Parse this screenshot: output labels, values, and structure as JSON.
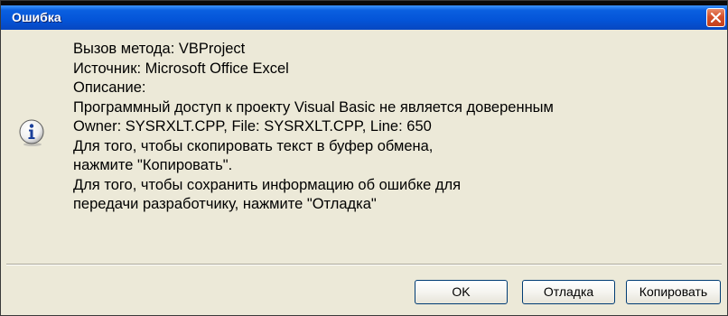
{
  "window": {
    "title": "Ошибка"
  },
  "icons": {
    "message_icon": "information-icon",
    "close_icon": "close-icon"
  },
  "message": {
    "lines": [
      "Вызов метода: VBProject",
      "Источник: Microsoft Office Excel",
      "Описание:",
      "Программный доступ к проекту Visual Basic не является доверенным",
      "Owner: SYSRXLT.CPP, File: SYSRXLT.CPP, Line: 650",
      "Для того, чтобы скопировать текст в буфер обмена,",
      "нажмите \"Копировать\".",
      "Для того, чтобы сохранить информацию об ошибке для",
      "передачи разработчику, нажмите \"Отладка\""
    ]
  },
  "buttons": {
    "ok_label": "OK",
    "debug_label": "Отладка",
    "copy_label": "Копировать"
  },
  "colors": {
    "titlebar": "#0454d8",
    "dialog_background": "#ece9d8",
    "close_button": "#d5502a",
    "button_border": "#003c74"
  }
}
